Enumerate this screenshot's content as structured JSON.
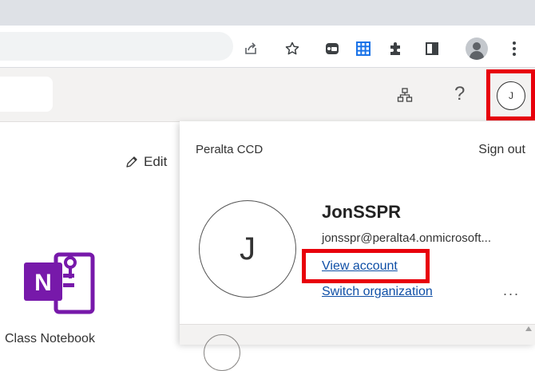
{
  "app_header": {
    "me_initial": "J"
  },
  "page": {
    "edit_label": "Edit",
    "notebook_label": "Class Notebook"
  },
  "account_flyout": {
    "org_name": "Peralta CCD",
    "sign_out_label": "Sign out",
    "avatar_initial": "J",
    "display_name": "JonSSPR",
    "email": "jonsspr@peralta4.onmicrosoft...",
    "view_account_label": "View account",
    "switch_org_label": "Switch organization",
    "more_label": "..."
  },
  "colors": {
    "highlight": "#e8000b",
    "link": "#0f4fa6",
    "onenote_purple": "#7719aa"
  },
  "icons": {
    "browser_toolbar": [
      "share-icon",
      "bookmark-star-icon",
      "extension-icon",
      "grid-extension-icon",
      "puzzle-icon",
      "side-panel-icon",
      "profile-icon",
      "kebab-menu-icon"
    ],
    "app_header": [
      "org-chart-icon",
      "help-icon"
    ]
  }
}
